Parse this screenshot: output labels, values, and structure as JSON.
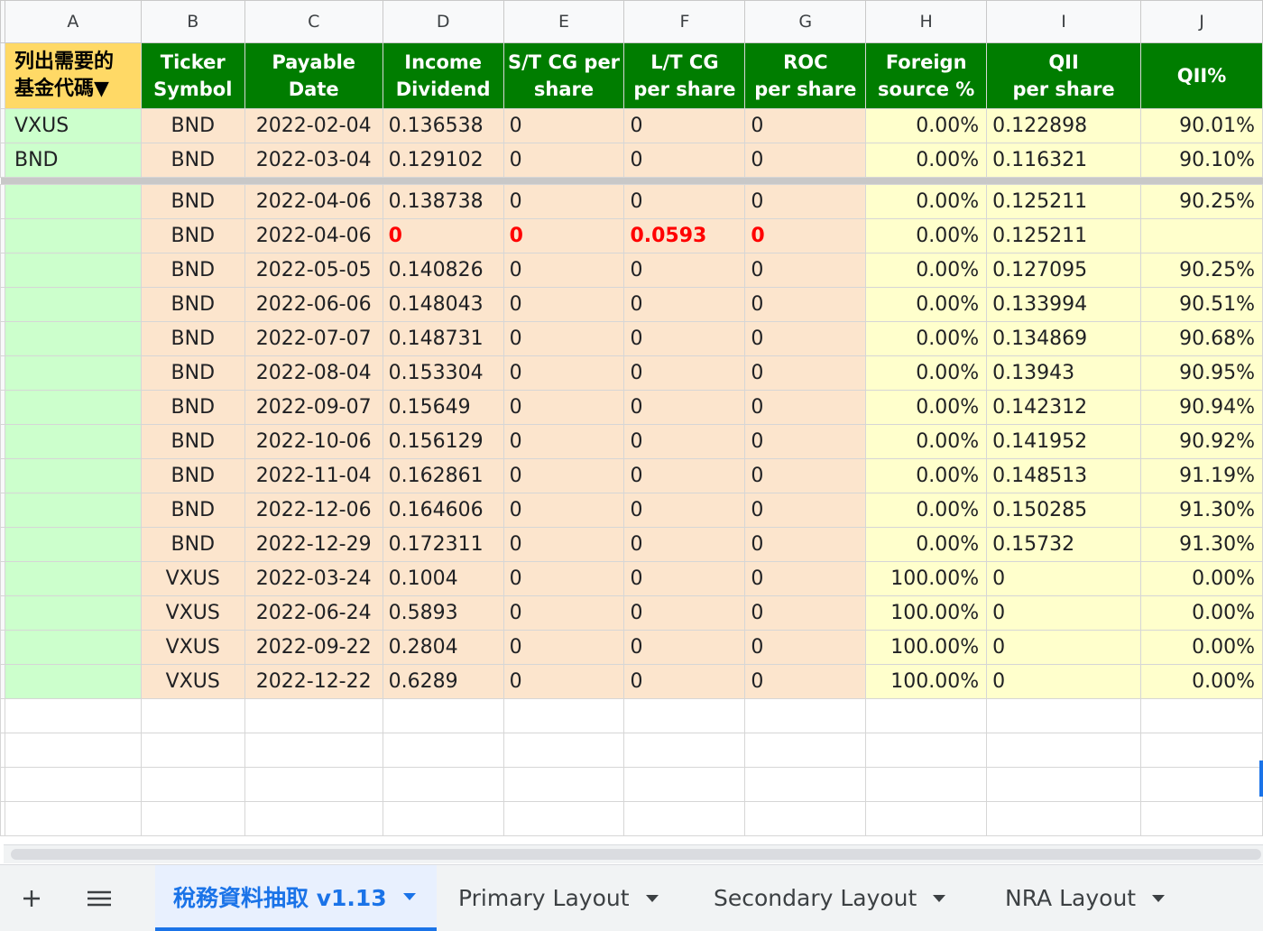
{
  "column_letters": [
    "A",
    "B",
    "C",
    "D",
    "E",
    "F",
    "G",
    "H",
    "I",
    "J"
  ],
  "header": {
    "a_line1": "列出需要的",
    "a_line2": "基金代碼▼",
    "b_line1": "Ticker",
    "b_line2": "Symbol",
    "c": "Payable Date",
    "d_line1": "Income",
    "d_line2": "Dividend",
    "e_line1": "S/T CG per",
    "e_line2": "share",
    "f_line1": "L/T CG",
    "f_line2": "per share",
    "g_line1": "ROC",
    "g_line2": "per share",
    "h_line1": "Foreign",
    "h_line2": "source %",
    "i_line1": "QII",
    "i_line2": "per share",
    "j": "QII%"
  },
  "rows": [
    {
      "a": "VXUS",
      "b": "BND",
      "c": "2022-02-04",
      "d": "0.136538",
      "e": "0",
      "f": "0",
      "g": "0",
      "h": "0.00%",
      "i": "0.122898",
      "j": "90.01%"
    },
    {
      "a": "BND",
      "b": "BND",
      "c": "2022-03-04",
      "d": "0.129102",
      "e": "0",
      "f": "0",
      "g": "0",
      "h": "0.00%",
      "i": "0.116321",
      "j": "90.10%"
    },
    {
      "a": "",
      "b": "BND",
      "c": "2022-04-06",
      "d": "0.138738",
      "e": "0",
      "f": "0",
      "g": "0",
      "h": "0.00%",
      "i": "0.125211",
      "j": "90.25%"
    },
    {
      "a": "",
      "b": "BND",
      "c": "2022-04-06",
      "d": "0",
      "e": "0",
      "f": "0.0593",
      "g": "0",
      "h": "0.00%",
      "i": "0.125211",
      "j": ""
    },
    {
      "a": "",
      "b": "BND",
      "c": "2022-05-05",
      "d": "0.140826",
      "e": "0",
      "f": "0",
      "g": "0",
      "h": "0.00%",
      "i": "0.127095",
      "j": "90.25%"
    },
    {
      "a": "",
      "b": "BND",
      "c": "2022-06-06",
      "d": "0.148043",
      "e": "0",
      "f": "0",
      "g": "0",
      "h": "0.00%",
      "i": "0.133994",
      "j": "90.51%"
    },
    {
      "a": "",
      "b": "BND",
      "c": "2022-07-07",
      "d": "0.148731",
      "e": "0",
      "f": "0",
      "g": "0",
      "h": "0.00%",
      "i": "0.134869",
      "j": "90.68%"
    },
    {
      "a": "",
      "b": "BND",
      "c": "2022-08-04",
      "d": "0.153304",
      "e": "0",
      "f": "0",
      "g": "0",
      "h": "0.00%",
      "i": "0.13943",
      "j": "90.95%"
    },
    {
      "a": "",
      "b": "BND",
      "c": "2022-09-07",
      "d": "0.15649",
      "e": "0",
      "f": "0",
      "g": "0",
      "h": "0.00%",
      "i": "0.142312",
      "j": "90.94%"
    },
    {
      "a": "",
      "b": "BND",
      "c": "2022-10-06",
      "d": "0.156129",
      "e": "0",
      "f": "0",
      "g": "0",
      "h": "0.00%",
      "i": "0.141952",
      "j": "90.92%"
    },
    {
      "a": "",
      "b": "BND",
      "c": "2022-11-04",
      "d": "0.162861",
      "e": "0",
      "f": "0",
      "g": "0",
      "h": "0.00%",
      "i": "0.148513",
      "j": "91.19%"
    },
    {
      "a": "",
      "b": "BND",
      "c": "2022-12-06",
      "d": "0.164606",
      "e": "0",
      "f": "0",
      "g": "0",
      "h": "0.00%",
      "i": "0.150285",
      "j": "91.30%"
    },
    {
      "a": "",
      "b": "BND",
      "c": "2022-12-29",
      "d": "0.172311",
      "e": "0",
      "f": "0",
      "g": "0",
      "h": "0.00%",
      "i": "0.15732",
      "j": "91.30%"
    },
    {
      "a": "",
      "b": "VXUS",
      "c": "2022-03-24",
      "d": "0.1004",
      "e": "0",
      "f": "0",
      "g": "0",
      "h": "100.00%",
      "i": "0",
      "j": "0.00%"
    },
    {
      "a": "",
      "b": "VXUS",
      "c": "2022-06-24",
      "d": "0.5893",
      "e": "0",
      "f": "0",
      "g": "0",
      "h": "100.00%",
      "i": "0",
      "j": "0.00%"
    },
    {
      "a": "",
      "b": "VXUS",
      "c": "2022-09-22",
      "d": "0.2804",
      "e": "0",
      "f": "0",
      "g": "0",
      "h": "100.00%",
      "i": "0",
      "j": "0.00%"
    },
    {
      "a": "",
      "b": "VXUS",
      "c": "2022-12-22",
      "d": "0.6289",
      "e": "0",
      "f": "0",
      "g": "0",
      "h": "100.00%",
      "i": "0",
      "j": "0.00%"
    }
  ],
  "highlight_row_index": 3,
  "colors": {
    "header_green": "#007d00",
    "header_yellow": "#ffd966",
    "col_a_green": "#ccffcc",
    "peach": "#fce5cd",
    "light_yellow": "#ffffcc",
    "highlight_red": "#ff0000",
    "tab_active": "#1a73e8"
  },
  "tabbar": {
    "add_icon": "plus-icon",
    "menu_icon": "hamburger-menu-icon",
    "tabs": [
      {
        "label": "稅務資料抽取 v1.13",
        "active": true
      },
      {
        "label": "Primary Layout",
        "active": false
      },
      {
        "label": "Secondary Layout",
        "active": false
      },
      {
        "label": "NRA Layout",
        "active": false
      }
    ]
  }
}
